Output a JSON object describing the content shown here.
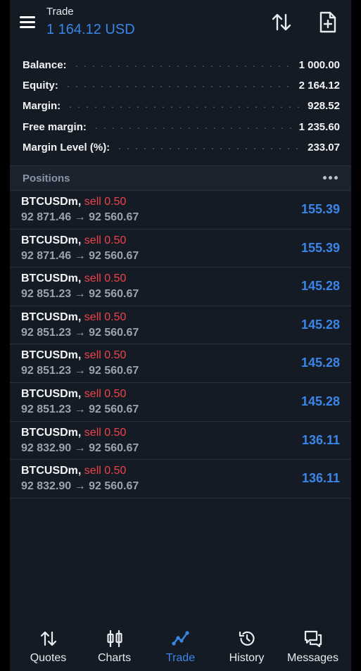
{
  "header": {
    "title": "Trade",
    "balance": "1 164.12 USD"
  },
  "summary": [
    {
      "label": "Balance:",
      "value": "1 000.00"
    },
    {
      "label": "Equity:",
      "value": "2 164.12"
    },
    {
      "label": "Margin:",
      "value": "928.52"
    },
    {
      "label": "Free margin:",
      "value": "1 235.60"
    },
    {
      "label": "Margin Level (%):",
      "value": "233.07"
    }
  ],
  "positions": {
    "title": "Positions",
    "rows": [
      {
        "symbol": "BTCUSDm,",
        "side": "sell 0.50",
        "prices": "92 871.46 → 92 560.67",
        "profit": "155.39"
      },
      {
        "symbol": "BTCUSDm,",
        "side": "sell 0.50",
        "prices": "92 871.46 → 92 560.67",
        "profit": "155.39"
      },
      {
        "symbol": "BTCUSDm,",
        "side": "sell 0.50",
        "prices": "92 851.23 → 92 560.67",
        "profit": "145.28"
      },
      {
        "symbol": "BTCUSDm,",
        "side": "sell 0.50",
        "prices": "92 851.23 → 92 560.67",
        "profit": "145.28"
      },
      {
        "symbol": "BTCUSDm,",
        "side": "sell 0.50",
        "prices": "92 851.23 → 92 560.67",
        "profit": "145.28"
      },
      {
        "symbol": "BTCUSDm,",
        "side": "sell 0.50",
        "prices": "92 851.23 → 92 560.67",
        "profit": "145.28"
      },
      {
        "symbol": "BTCUSDm,",
        "side": "sell 0.50",
        "prices": "92 832.90 → 92 560.67",
        "profit": "136.11"
      },
      {
        "symbol": "BTCUSDm,",
        "side": "sell 0.50",
        "prices": "92 832.90 → 92 560.67",
        "profit": "136.11"
      }
    ]
  },
  "nav": [
    {
      "label": "Quotes",
      "icon": "quotes-icon"
    },
    {
      "label": "Charts",
      "icon": "charts-icon"
    },
    {
      "label": "Trade",
      "icon": "trade-icon",
      "active": true
    },
    {
      "label": "History",
      "icon": "history-icon"
    },
    {
      "label": "Messages",
      "icon": "messages-icon"
    }
  ],
  "colors": {
    "background": "#141b24",
    "accent": "#3a86e8",
    "sell": "#f0424a",
    "muted": "#9aa3ae"
  }
}
